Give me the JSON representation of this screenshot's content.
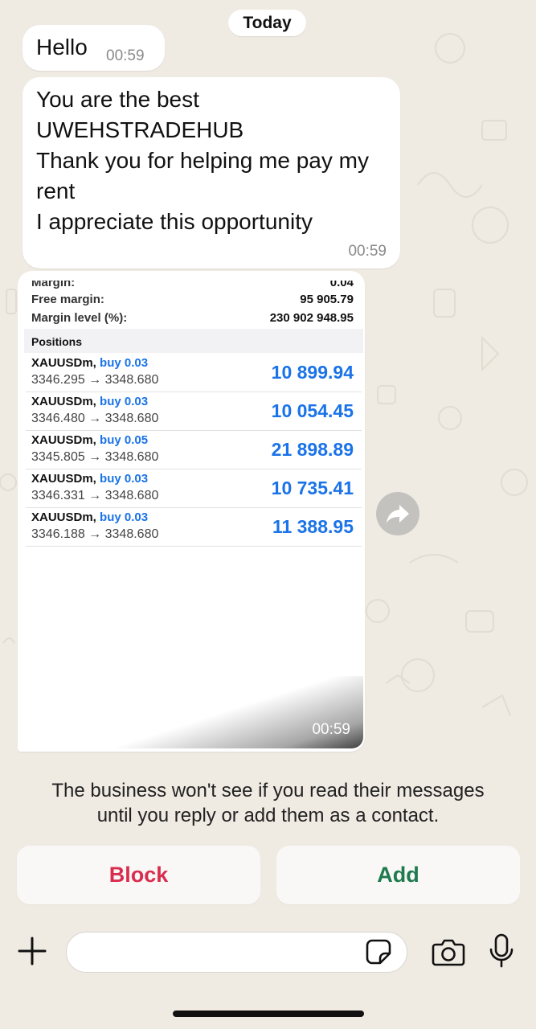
{
  "date_label": "Today",
  "messages": [
    {
      "text": "Hello",
      "time": "00:59"
    },
    {
      "lines": [
        "You are the best",
        "UWEHSTRADEHUB",
        "Thank you for helping me pay my",
        "rent",
        "I appreciate this opportunity"
      ],
      "time": "00:59"
    }
  ],
  "image_message": {
    "time": "00:59",
    "account": {
      "margin_label": "Margin:",
      "margin_value": "0.04",
      "free_margin_label": "Free margin:",
      "free_margin_value": "95 905.79",
      "margin_level_label": "Margin level (%):",
      "margin_level_value": "230 902 948.95"
    },
    "positions_title": "Positions",
    "positions": [
      {
        "symbol": "XAUUSDm,",
        "side": "buy 0.03",
        "prices": "3346.295 → 3348.680",
        "profit": "10 899.94"
      },
      {
        "symbol": "XAUUSDm,",
        "side": "buy 0.03",
        "prices": "3346.480 → 3348.680",
        "profit": "10 054.45"
      },
      {
        "symbol": "XAUUSDm,",
        "side": "buy 0.05",
        "prices": "3345.805 → 3348.680",
        "profit": "21 898.89"
      },
      {
        "symbol": "XAUUSDm,",
        "side": "buy 0.03",
        "prices": "3346.331 → 3348.680",
        "profit": "10 735.41"
      },
      {
        "symbol": "XAUUSDm,",
        "side": "buy 0.03",
        "prices": "3346.188 → 3348.680",
        "profit": "11 388.95"
      }
    ]
  },
  "notice": {
    "line1": "The business won't see if you read their messages",
    "line2": "until you reply or add them as a contact."
  },
  "actions": {
    "block_label": "Block",
    "add_label": "Add"
  },
  "composer": {
    "placeholder": ""
  },
  "icons": {
    "forward": "forward-arrow-icon",
    "attach": "plus-icon",
    "sticker": "sticker-icon",
    "camera": "camera-icon",
    "mic": "microphone-icon"
  },
  "colors": {
    "chat_background": "#efeae2",
    "bubble": "#ffffff",
    "profit_blue": "#1a73e8",
    "block_red": "#d92d4f",
    "add_green": "#1f7a4d"
  }
}
